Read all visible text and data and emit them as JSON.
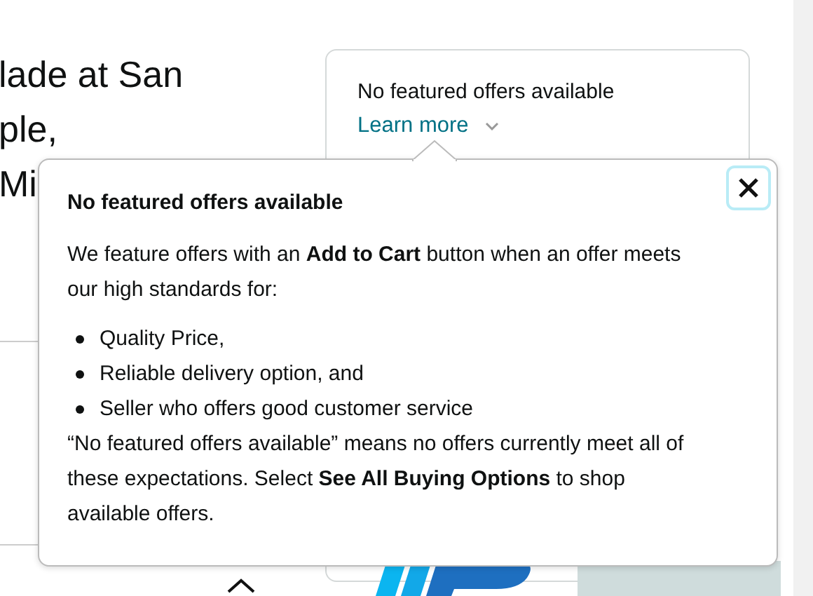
{
  "product_title_lines": [
    "lade at San",
    "ple,",
    "Mi"
  ],
  "offer_card": {
    "message": "No featured offers available",
    "link": "Learn more"
  },
  "popover": {
    "title": "No featured offers available",
    "intro": "We feature offers with an **Add to Cart** button when an offer meets our high standards for:",
    "criteria": [
      "Quality Price,",
      "Reliable delivery option, and",
      "Seller who offers good customer service"
    ],
    "explanation": "“No featured offers available” means no offers currently meet all of these expectations. Select **See All Buying Options** to shop available offers."
  }
}
